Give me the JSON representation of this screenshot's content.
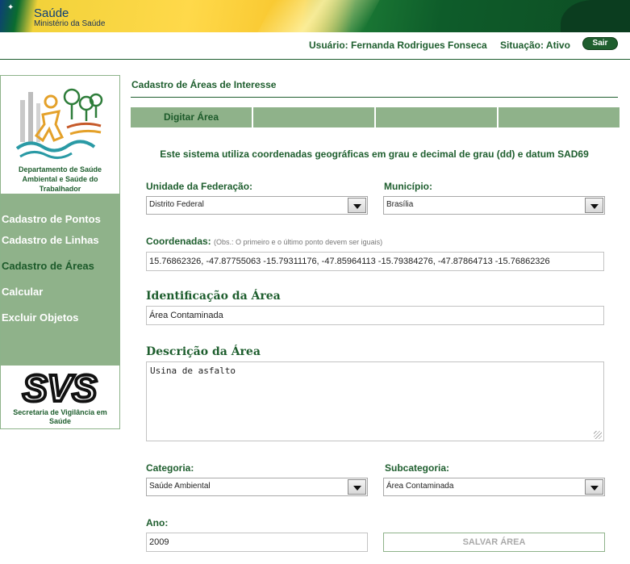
{
  "header": {
    "brand_title": "Saúde",
    "brand_subtitle": "Ministério da Saúde",
    "user": "Usuário: Fernanda Rodrigues Fonseca",
    "status": "Situação: Ativo",
    "logout_label": "Sair"
  },
  "sidebar": {
    "department": "Departamento de Saúde Ambiental e Saúde do Trabalhador",
    "menu": [
      {
        "label": "Cadastro de Pontos"
      },
      {
        "label": "Cadastro de Linhas"
      },
      {
        "label": "Cadastro de Áreas"
      },
      {
        "label": "Calcular"
      },
      {
        "label": "Excluir Objetos"
      }
    ],
    "active_item": "Cadastro de Áreas",
    "secretariat": "Secretaria de Vigilância em Saúde"
  },
  "main": {
    "title": "Cadastro de Áreas de Interesse",
    "tabs": [
      {
        "label": "Digitar Área"
      },
      {
        "label": ""
      },
      {
        "label": ""
      },
      {
        "label": ""
      }
    ],
    "info": "Este sistema utiliza coordenadas geográficas em grau e decimal de grau (dd) e datum SAD69",
    "uf": {
      "label": "Unidade da Federação:",
      "value": "Distrito Federal"
    },
    "municipio": {
      "label": "Município:",
      "value": "Brasília"
    },
    "coordenadas": {
      "label": "Coordenadas:",
      "note": "(Obs.: O primeiro e o último ponto devem ser iguais)",
      "value": "15.76862326, -47.87755063 -15.79311176, -47.85964113 -15.79384276, -47.87864713 -15.76862326"
    },
    "identificacao": {
      "label": "Identificação da Área",
      "value": "Área Contaminada"
    },
    "descricao": {
      "label": "Descrição da Área",
      "value": "Usina de asfalto"
    },
    "categoria": {
      "label": "Categoria:",
      "value": "Saúde Ambiental"
    },
    "subcategoria": {
      "label": "Subcategoria:",
      "value": "Área Contaminada"
    },
    "ano": {
      "label": "Ano:",
      "value": "2009"
    },
    "save_label": "SALVAR ÁREA"
  },
  "colors": {
    "primary_green": "#1e5e2e",
    "menu_green": "#8fb28a",
    "banner_yellow": "#ffd94a"
  }
}
